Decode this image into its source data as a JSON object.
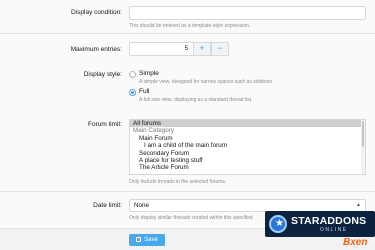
{
  "display_condition": {
    "label": "Display condition:",
    "value": "",
    "hint": "This should be entered as a template-style expression."
  },
  "maximum_entries": {
    "label": "Maximum entries:",
    "value": "5",
    "increment_symbol": "+",
    "decrement_symbol": "−"
  },
  "display_style": {
    "label": "Display style:",
    "selected": "Full",
    "options": [
      {
        "label": "Simple",
        "hint": "A simple view, designed for narrow spaces such as sidebars."
      },
      {
        "label": "Full",
        "hint": "A full size view, displaying as a standard thread list."
      }
    ]
  },
  "forum_limit": {
    "label": "Forum limit:",
    "items": [
      "All forums",
      "Main Category",
      "Main Forum",
      "I am a child of the main forum",
      "Secondary Forum",
      "A place for testing stuff",
      "The Article Forum"
    ],
    "selected": "All forums",
    "hint": "Only include threads in the selected forums."
  },
  "date_limit": {
    "label": "Date limit:",
    "value": "None",
    "hint": "Only display similar threads created within this specified"
  },
  "footer": {
    "save_label": "Save"
  },
  "watermark": {
    "title": "STARADDONS",
    "subtitle": "ONLINE",
    "secondary": "Bxen"
  },
  "colors": {
    "accent": "#47a7eb",
    "border": "#d8d8d8",
    "hint_text": "#8c8c8c"
  }
}
